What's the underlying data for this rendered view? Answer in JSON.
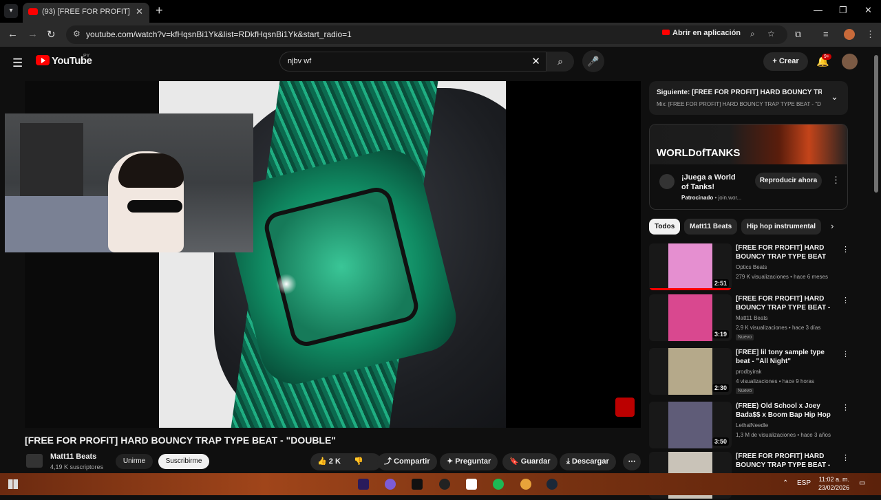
{
  "browser": {
    "tab_title": "(93) [FREE FOR PROFIT] HARD BOUNCY TRAP TYPE BEAT",
    "url": "youtube.com/watch?v=kfHqsnBi1Yk&list=RDkfHqsnBi1Yk&start_radio=1",
    "open_in_app": "Abrir en aplicación",
    "new_tab_symbol": "+",
    "close_symbol": "✕",
    "minimize_symbol": "—",
    "maximize_symbol": "❐"
  },
  "header": {
    "logo_text": "YouTube",
    "country_code": "PY",
    "search_value": "njbv wf",
    "create_label": "Crear",
    "notification_count": "9+"
  },
  "player": {
    "title": "[FREE FOR PROFIT] HARD BOUNCY TRAP TYPE BEAT - \"DOUBLE\""
  },
  "channel": {
    "name": "Matt11 Beats",
    "subscribers": "4,19 K suscriptores",
    "join_label": "Unirme",
    "subscribe_label": "Suscribirme"
  },
  "actions": {
    "like_count": "2 K",
    "share": "Compartir",
    "ask": "Preguntar",
    "save": "Guardar",
    "download": "Descargar"
  },
  "up_next": {
    "title": "Siguiente: [FREE FOR PROFIT] HARD BOUNCY TRA...",
    "subtitle": "Mix: [FREE FOR PROFIT] HARD BOUNCY TRAP TYPE BEAT - \"D"
  },
  "ad": {
    "brand": "WORLDofTANKS",
    "headline": "¡Juega a World of Tanks!",
    "sponsored": "Patrocinado",
    "domain": "join.wor...",
    "cta": "Reproducir ahora"
  },
  "chips": [
    "Todos",
    "Matt11 Beats",
    "Hip hop instrumental"
  ],
  "recommendations": [
    {
      "title": "[FREE FOR PROFIT] HARD BOUNCY TRAP TYPE BEAT ...",
      "channel": "Optics Beats",
      "meta": "279 K visualizaciones • hace 6 meses",
      "duration": "2:51",
      "badge": "",
      "progress": 1.0,
      "thumb_color": "#e58fd0"
    },
    {
      "title": "[FREE FOR PROFIT] HARD BOUNCY TRAP TYPE BEAT - ...",
      "channel": "Matt11 Beats",
      "meta": "2,9 K visualizaciones • hace 3 días",
      "duration": "3:19",
      "badge": "Nuevo",
      "progress": 0,
      "thumb_color": "#d9488f"
    },
    {
      "title": "[FREE] lil tony sample type beat - \"All Night\"",
      "channel": "prodbyirak",
      "meta": "4 visualizaciones • hace 9 horas",
      "duration": "2:30",
      "badge": "Nuevo",
      "progress": 0,
      "thumb_color": "#b5a98a"
    },
    {
      "title": "(FREE) Old School x Joey Bada$$ x Boom Bap Hip Hop ...",
      "channel": "LethalNeedle",
      "meta": "1,3 M de visualizaciones • hace 3 años",
      "duration": "3:50",
      "badge": "",
      "progress": 0,
      "thumb_color": "#5f5c78"
    },
    {
      "title": "[FREE FOR PROFIT] HARD BOUNCY TRAP TYPE BEAT - ...",
      "channel": "",
      "meta": "",
      "duration": "",
      "badge": "",
      "progress": 0,
      "thumb_color": "#c9c3b8"
    }
  ],
  "taskbar": {
    "language": "ESP",
    "time": "11:02 a. m.",
    "date": "23/02/2026"
  },
  "colors": {
    "accent": "#ff0000",
    "background": "#0f0f0f"
  }
}
